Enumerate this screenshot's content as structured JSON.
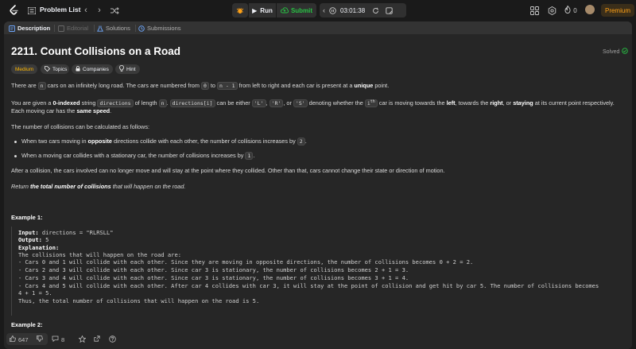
{
  "topbar": {
    "problem_list": "Problem List",
    "run": "Run",
    "submit": "Submit",
    "timer": "03:01:38",
    "fire_count": "0",
    "premium": "Premium"
  },
  "tabs": {
    "description": "Description",
    "editorial": "Editorial",
    "solutions": "Solutions",
    "submissions": "Submissions"
  },
  "problem": {
    "title": "2211. Count Collisions on a Road",
    "status": "Solved",
    "difficulty": "Medium",
    "chips": [
      "Topics",
      "Companies",
      "Hint"
    ]
  },
  "description": {
    "p1_a": "There are ",
    "p1_code1": "n",
    "p1_b": " cars on an infinitely long road. The cars are numbered from ",
    "p1_code2": "0",
    "p1_c": " to ",
    "p1_code3": "n - 1",
    "p1_d": " from left to right and each car is present at a ",
    "p1_bold": "unique",
    "p1_e": " point.",
    "p2_a": "You are given a ",
    "p2_bold1": "0-indexed",
    "p2_b": " string ",
    "p2_code1": "directions",
    "p2_c": " of length ",
    "p2_code2": "n",
    "p2_d": ". ",
    "p2_code3": "directions[i]",
    "p2_e": " can be either ",
    "p2_code4": "'L'",
    "p2_f": ", ",
    "p2_code5": "'R'",
    "p2_g": ", or ",
    "p2_code6": "'S'",
    "p2_h": " denoting whether the ",
    "p2_code7": "i",
    "p2_sup": "th",
    "p2_i": " car is moving towards the ",
    "p2_bold2": "left",
    "p2_j": ", towards the ",
    "p2_bold3": "right",
    "p2_k": ", or ",
    "p2_bold4": "staying",
    "p2_l": " at its current point respectively.",
    "p2_line2_a": "Each moving car has the ",
    "p2_line2_bold": "same speed",
    "p2_line2_b": ".",
    "p3": "The number of collisions can be calculated as follows:",
    "b1_a": "When two cars moving in ",
    "b1_bold": "opposite",
    "b1_b": " directions collide with each other, the number of collisions increases by ",
    "b1_code": "2",
    "b1_c": ".",
    "b2_a": "When a moving car collides with a stationary car, the number of collisions increases by ",
    "b2_code": "1",
    "b2_b": ".",
    "p4": "After a collision, the cars involved can no longer move and will stay at the point where they collided. Other than that, cars cannot change their state or direction of motion.",
    "p5_a": "Return ",
    "p5_bold": "the total number of collisions",
    "p5_b": " that will happen on the road."
  },
  "example1": {
    "title": "Example 1:",
    "input_label": "Input:",
    "input_value": " directions = \"RLRSLL\"",
    "output_label": "Output:",
    "output_value": " 5",
    "explanation_label": "Explanation:",
    "lines": [
      "The collisions that will happen on the road are:",
      "- Cars 0 and 1 will collide with each other. Since they are moving in opposite directions, the number of collisions becomes 0 + 2 = 2.",
      "- Cars 2 and 3 will collide with each other. Since car 3 is stationary, the number of collisions becomes 2 + 1 = 3.",
      "- Cars 3 and 4 will collide with each other. Since car 3 is stationary, the number of collisions becomes 3 + 1 = 4.",
      "- Cars 4 and 5 will collide with each other. After car 4 collides with car 3, it will stay at the point of collision and get hit by car 5. The number of collisions becomes",
      "4 + 1 = 5.",
      "Thus, the total number of collisions that will happen on the road is 5."
    ]
  },
  "example2": {
    "title": "Example 2:"
  },
  "bottom": {
    "likes": "647",
    "comments": "8"
  }
}
